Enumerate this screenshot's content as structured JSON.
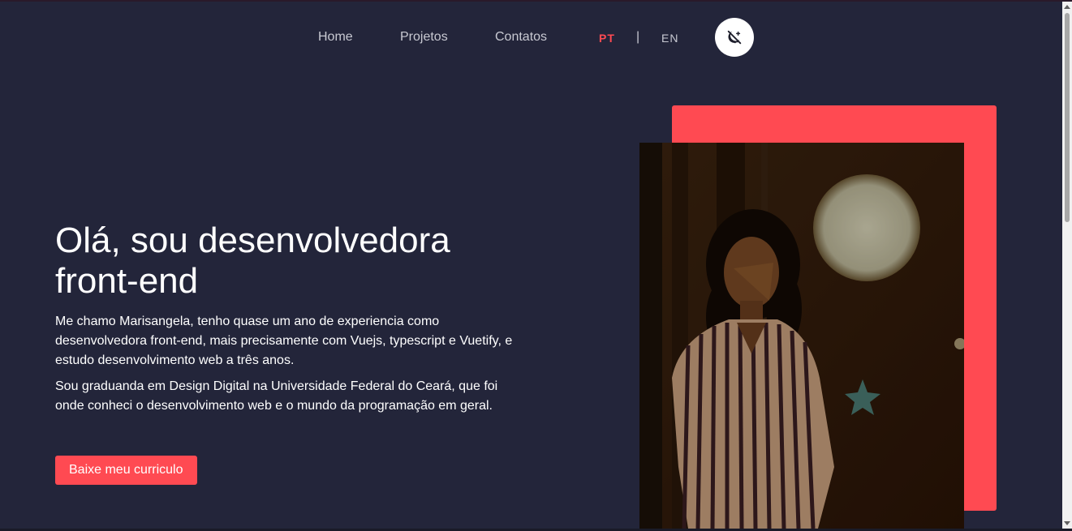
{
  "nav": {
    "items": [
      {
        "label": "Home"
      },
      {
        "label": "Projetos"
      },
      {
        "label": "Contatos"
      }
    ],
    "lang_pt": "PT",
    "lang_separator": "|",
    "lang_en": "EN",
    "theme_toggle_icon": "theme-toggle-icon"
  },
  "hero": {
    "title_line1": "Olá, sou desenvolvedora",
    "title_line2": "front-end",
    "paragraph1": "Me chamo Marisangela, tenho quase um ano de experiencia como desenvolvedora front-end, mais precisamente com Vuejs, typescript e Vuetify, e estudo desenvolvimento web a três anos.",
    "paragraph2": "Sou graduanda em Design Digital na Universidade Federal do Ceará, que foi onde conheci o desenvolvimento web e o mundo da programação em geral.",
    "cta_label": "Baixe meu curriculo"
  },
  "colors": {
    "background": "#23253a",
    "accent": "#ff4a52",
    "text": "#ffffff",
    "nav_text": "#c8c9d2"
  }
}
